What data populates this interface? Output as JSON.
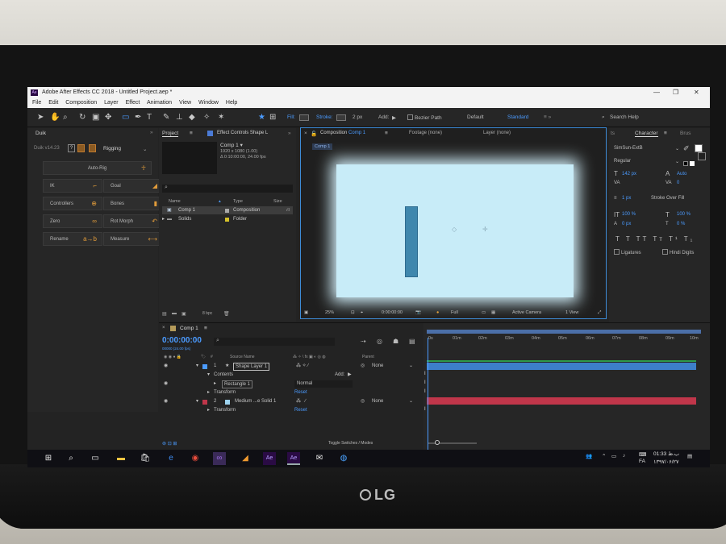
{
  "app": {
    "title": "Adobe After Effects CC 2018 - Untitled Project.aep *",
    "menu": [
      "File",
      "Edit",
      "Composition",
      "Layer",
      "Effect",
      "Animation",
      "View",
      "Window",
      "Help"
    ]
  },
  "toolbar": {
    "fill_label": "Fill:",
    "stroke_label": "Stroke:",
    "stroke_width": "2 px",
    "add_label": "Add:",
    "bezier_label": "Bezier Path",
    "workspace_default": "Default",
    "workspace_standard": "Standard",
    "search_placeholder": "Search Help"
  },
  "duik": {
    "tab": "Duik",
    "version": "Duik v14.23",
    "mode": "Rigging",
    "autorig": "Auto-Rig",
    "buttons": [
      {
        "label": "IK",
        "icon": "ik-icon"
      },
      {
        "label": "Goal",
        "icon": "goal-icon"
      },
      {
        "label": "Controllers",
        "icon": "controllers-icon"
      },
      {
        "label": "Bones",
        "icon": "bones-icon"
      },
      {
        "label": "Zero",
        "icon": "zero-icon"
      },
      {
        "label": "Rot Morph",
        "icon": "rot-morph-icon"
      },
      {
        "label": "Rename",
        "icon": "rename-icon"
      },
      {
        "label": "Measure",
        "icon": "measure-icon"
      }
    ]
  },
  "project": {
    "tab": "Project",
    "effects_tab": "Effect Controls Shape L",
    "comp_name": "Comp 1 ▾",
    "comp_size": "1920 x 1080 (1.00)",
    "comp_duration": "Δ 0:10:00:00, 24.00 fps",
    "col_name": "Name",
    "col_type": "Type",
    "col_size": "Size",
    "items": [
      {
        "name": "Comp 1",
        "type": "Composition"
      },
      {
        "name": "Solids",
        "type": "Folder"
      }
    ],
    "bpc": "8 bpc"
  },
  "viewer": {
    "tab_composition": "Composition",
    "comp_label": "Comp 1",
    "tab_footage": "Footage (none)",
    "tab_layer": "Layer (none)",
    "breadcrumb": "Comp 1",
    "zoom": "25%",
    "timecode": "0:00:00:00",
    "resolution": "Full",
    "camera": "Active Camera",
    "views": "1 View"
  },
  "character": {
    "tab": "Character",
    "tab2": "Brus",
    "font": "SimSun-ExtB",
    "style": "Regular",
    "font_size": "142 px",
    "leading": "Auto",
    "tracking": "0",
    "stroke_width": "1 px",
    "stroke_mode": "Stroke Over Fill",
    "vscale": "100 %",
    "hscale": "100 %",
    "baseline": "0 px",
    "tsume": "0 %",
    "ligatures": "Ligatures",
    "hindi": "Hindi Digits"
  },
  "timeline": {
    "tab": "Comp 1",
    "timecode": "0:00:00:00",
    "frame_info": "00000 (24.00 fps)",
    "col_source": "Source Name",
    "col_parent": "Parent",
    "ruler": [
      "0s",
      "01m",
      "02m",
      "03m",
      "04m",
      "05m",
      "06m",
      "07m",
      "08m",
      "09m",
      "10m"
    ],
    "layers": [
      {
        "num": "1",
        "name": "Shape Layer 1",
        "parent": "None"
      },
      {
        "num": "2",
        "name": "Medium ...e Solid 1",
        "parent": "None"
      }
    ],
    "contents": "Contents",
    "add": "Add:",
    "rectangle": "Rectangle 1",
    "blend": "Normal",
    "reset": "Reset",
    "transform": "Transform",
    "toggle": "Toggle Switches / Modes"
  },
  "taskbar": {
    "time": "01:33 ب.ظ",
    "date": "۱۳۹۷/۰۶/۲۷",
    "lang": "FA"
  },
  "colors": {
    "accent": "#4b9bff",
    "canvas": "#c8ecf8",
    "shape": "#3f87ad",
    "solid_track": "#c0364a",
    "shape_track": "#3d7fc9"
  }
}
